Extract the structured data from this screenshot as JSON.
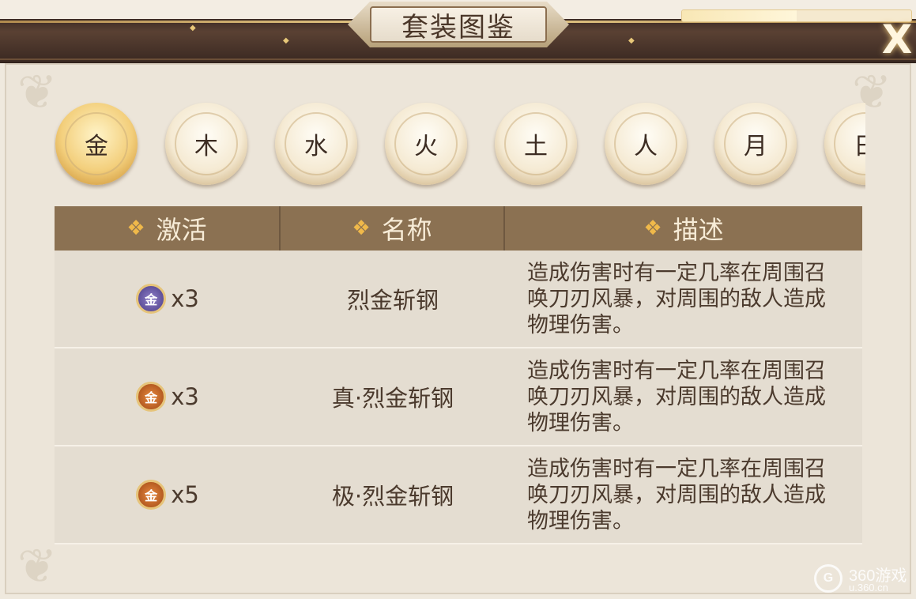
{
  "title": "套装图鉴",
  "close_label": "X",
  "top_progress": 0.5,
  "tabs": [
    {
      "label": "金",
      "active": true
    },
    {
      "label": "木",
      "active": false
    },
    {
      "label": "水",
      "active": false
    },
    {
      "label": "火",
      "active": false
    },
    {
      "label": "土",
      "active": false
    },
    {
      "label": "人",
      "active": false
    },
    {
      "label": "月",
      "active": false
    },
    {
      "label": "日",
      "active": false
    }
  ],
  "table": {
    "headers": [
      "激活",
      "名称",
      "描述"
    ],
    "rows": [
      {
        "badge_text": "金",
        "badge_color": "#5b4c9a",
        "quantity": "x3",
        "name": "烈金斩钢",
        "description": "造成伤害时有一定几率在周围召唤刀刃风暴，对周围的敌人造成物理伤害。"
      },
      {
        "badge_text": "金",
        "badge_color": "#c2611f",
        "quantity": "x3",
        "name": "真·烈金斩钢",
        "description": "造成伤害时有一定几率在周围召唤刀刃风暴，对周围的敌人造成物理伤害。"
      },
      {
        "badge_text": "金",
        "badge_color": "#c2611f",
        "quantity": "x5",
        "name": "极·烈金斩钢",
        "description": "造成伤害时有一定几率在周围召唤刀刃风暴，对周围的敌人造成物理伤害。"
      }
    ]
  },
  "watermark": {
    "name": "360游戏",
    "url": "u.360.cn"
  },
  "colors": {
    "header_bg": "#8b7152",
    "accent_gold": "#f0b94a",
    "text_dark": "#4b3a2d"
  }
}
